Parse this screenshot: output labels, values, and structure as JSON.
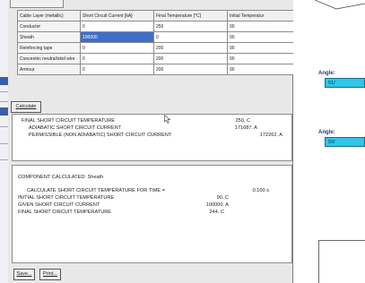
{
  "table": {
    "headers": [
      "Cable Layer (metallic)",
      "Short Circuit Current [kA]",
      "Final Temperature [°C]",
      "Initial Temperatur"
    ],
    "rows": [
      {
        "layer": "Conductor",
        "current": "0",
        "final": "250",
        "initial": "90"
      },
      {
        "layer": "Sheath",
        "current": "100000",
        "final": "0",
        "initial": "90"
      },
      {
        "layer": "Reinforcing tape",
        "current": "0",
        "final": "200",
        "initial": "90"
      },
      {
        "layer": "Concentric neutral/skid wire",
        "current": "0",
        "final": "200",
        "initial": "90"
      },
      {
        "layer": "Armour",
        "current": "0",
        "final": "200",
        "initial": "90"
      }
    ]
  },
  "buttons": {
    "calculate": "Calculate",
    "save": "Save...",
    "print": "Print..."
  },
  "results1": {
    "final_label": "FINAL SHORT CIRCUIT TEMPERATURE",
    "final_value": "250. C",
    "adiabatic_label": "ADIABATIC SHORT CIRCUIT CURRENT",
    "adiabatic_value": "171687. A",
    "permissible_label": "PERMISSIBLE (NON ADIABATIC) SHORT CIRCUIT CURRENT",
    "permissible_value": "172262. A"
  },
  "results2": {
    "component_label": "COMPONENT CALCULATED: Sheath",
    "time_label": "CALCULATE SHORT CIRCUIT TEMPERATURE FOR TIME =",
    "time_value": "0.100 s",
    "initial_label": "INITIAL SHORT CIRCUIT TEMPERATURE",
    "initial_value": "90. C",
    "given_label": "GIVEN SHORT CIRCUIT CURRENT",
    "given_value": "100000. A",
    "final_label": "FINAL SHORT CIRCUIT TEMPERATURE",
    "final_value": "244. C"
  },
  "right_window": {
    "angle1_label": "Angle:",
    "angle1_value": "51/",
    "angle2_label": "Angle:",
    "angle2_value": "59/"
  },
  "colors": {
    "selection": "#3f6ec8",
    "angle_box": "#2fc6e8",
    "angle_label": "#1f3a7a"
  }
}
